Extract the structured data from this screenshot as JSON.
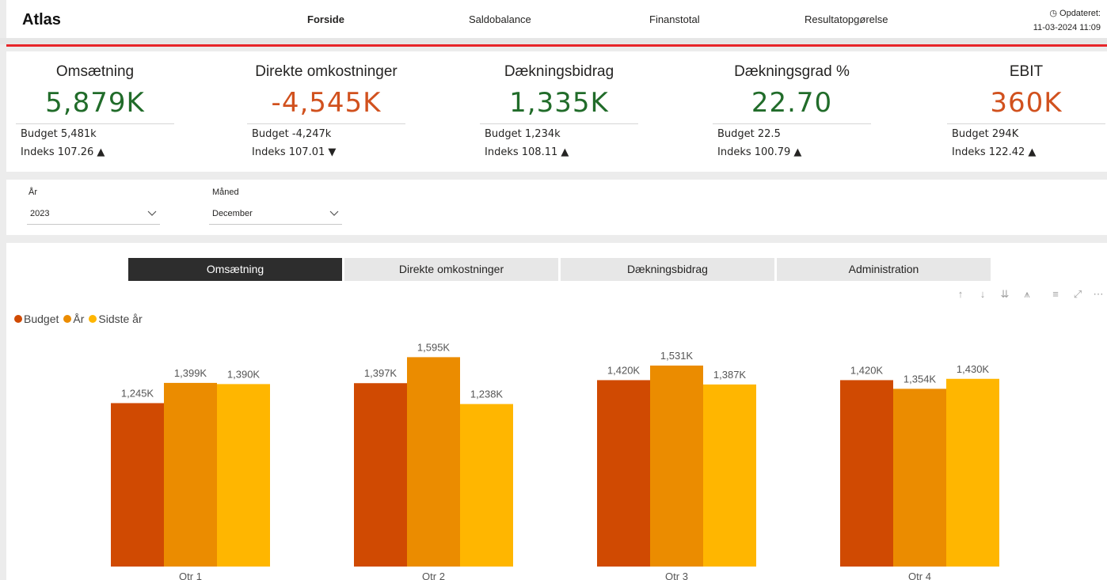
{
  "app": {
    "title": "Atlas"
  },
  "nav": {
    "items": [
      {
        "label": "Forside",
        "active": true
      },
      {
        "label": "Saldobalance",
        "active": false
      },
      {
        "label": "Finanstotal",
        "active": false
      },
      {
        "label": "Resultatopgørelse",
        "active": false
      }
    ],
    "updated_label": "◷ Opdateret:",
    "updated_value": "11-03-2024 11:09"
  },
  "kpis": [
    {
      "title": "Omsætning",
      "value": "5,879K",
      "budget": "Budget 5,481k",
      "index": "Indeks 107.26 ▲",
      "tone": "green"
    },
    {
      "title": "Direkte omkostninger",
      "value": "-4,545K",
      "budget": "Budget -4,247k",
      "index": "Indeks 107.01 ▼",
      "tone": "red"
    },
    {
      "title": "Dækningsbidrag",
      "value": "1,335K",
      "budget": "Budget 1,234k",
      "index": "Indeks 108.11 ▲",
      "tone": "green"
    },
    {
      "title": "Dækningsgrad %",
      "value": "22.70",
      "budget": "Budget 22.5",
      "index": "Indeks 100.79 ▲",
      "tone": "green"
    },
    {
      "title": "EBIT",
      "value": "360K",
      "budget": "Budget 294K",
      "index": "Indeks 122.42 ▲",
      "tone": "red"
    }
  ],
  "filters": {
    "year": {
      "label": "År",
      "value": "2023"
    },
    "month": {
      "label": "Måned",
      "value": "December"
    }
  },
  "tabs": [
    {
      "label": "Omsætning",
      "active": true
    },
    {
      "label": "Direkte omkostninger",
      "active": false
    },
    {
      "label": "Dækningsbidrag",
      "active": false
    },
    {
      "label": "Administration",
      "active": false
    }
  ],
  "toolbar_icons": [
    "arrow-up-icon",
    "arrow-down-icon",
    "double-arrow-down-icon",
    "drill-icon",
    "filter-icon",
    "focus-mode-icon",
    "more-options-icon"
  ],
  "colors": {
    "budget": "#d04a02",
    "year": "#eb8c00",
    "last_year": "#ffb600",
    "green": "#216c2a",
    "red": "#d1511e",
    "accent_line": "#e8262a"
  },
  "chart_data": {
    "type": "bar",
    "categories": [
      "Qtr 1",
      "Qtr 2",
      "Qtr 3",
      "Qtr 4"
    ],
    "series": [
      {
        "name": "Budget",
        "values": [
          1245,
          1397,
          1420,
          1420
        ],
        "labels": [
          "1,245K",
          "1,397K",
          "1,420K",
          "1,420K"
        ],
        "color": "#d04a02"
      },
      {
        "name": "År",
        "values": [
          1399,
          1595,
          1531,
          1354
        ],
        "labels": [
          "1,399K",
          "1,595K",
          "1,531K",
          "1,354K"
        ],
        "color": "#eb8c00"
      },
      {
        "name": "Sidste år",
        "values": [
          1390,
          1238,
          1387,
          1430
        ],
        "labels": [
          "1,390K",
          "1,238K",
          "1,387K",
          "1,430K"
        ],
        "color": "#ffb600"
      }
    ],
    "ylim": [
      0,
      1700
    ],
    "legend_position": "top-left",
    "grid": false
  }
}
